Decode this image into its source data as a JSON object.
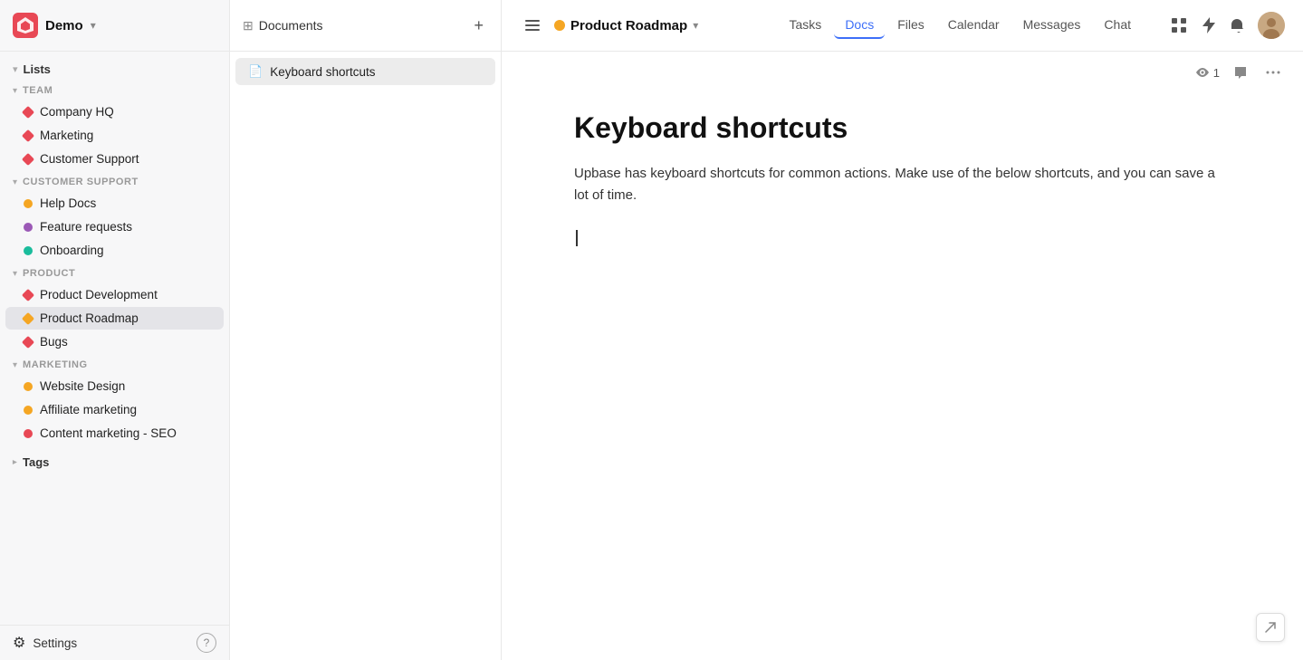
{
  "app": {
    "workspace": "Demo"
  },
  "sidebar": {
    "lists_label": "Lists",
    "team_section": "TEAM",
    "team_items": [
      {
        "label": "Company HQ",
        "color": "#e84855",
        "type": "diamond"
      },
      {
        "label": "Marketing",
        "color": "#e84855",
        "type": "diamond"
      },
      {
        "label": "Customer Support",
        "color": "#e84855",
        "type": "diamond"
      }
    ],
    "customer_support_section": "CUSTOMER SUPPORT",
    "customer_support_items": [
      {
        "label": "Help Docs",
        "color": "#f5a623",
        "type": "dot"
      },
      {
        "label": "Feature requests",
        "color": "#9b59b6",
        "type": "dot"
      },
      {
        "label": "Onboarding",
        "color": "#1abc9c",
        "type": "dot"
      }
    ],
    "product_section": "PRODUCT",
    "product_items": [
      {
        "label": "Product Development",
        "color": "#e84855",
        "type": "diamond"
      },
      {
        "label": "Product Roadmap",
        "color": "#f5a623",
        "type": "diamond",
        "active": true
      },
      {
        "label": "Bugs",
        "color": "#e84855",
        "type": "diamond"
      }
    ],
    "marketing_section": "MARKETING",
    "marketing_items": [
      {
        "label": "Website Design",
        "color": "#f5a623",
        "type": "dot"
      },
      {
        "label": "Affiliate marketing",
        "color": "#f5a623",
        "type": "dot"
      },
      {
        "label": "Content marketing - SEO",
        "color": "#e84855",
        "type": "dot"
      }
    ],
    "tags_label": "Tags",
    "settings_label": "Settings"
  },
  "docs_panel": {
    "title": "Documents",
    "add_button": "+",
    "items": [
      {
        "label": "Keyboard shortcuts",
        "active": true
      }
    ]
  },
  "topbar": {
    "project_name": "Product Roadmap",
    "nav_items": [
      {
        "label": "Tasks",
        "active": false
      },
      {
        "label": "Docs",
        "active": true
      },
      {
        "label": "Files",
        "active": false
      },
      {
        "label": "Calendar",
        "active": false
      },
      {
        "label": "Messages",
        "active": false
      },
      {
        "label": "Chat",
        "active": false
      }
    ],
    "viewers_count": "1"
  },
  "document": {
    "title": "Keyboard shortcuts",
    "body": "Upbase has keyboard shortcuts for common actions. Make use of the below shortcuts, and you can save a lot of time."
  }
}
